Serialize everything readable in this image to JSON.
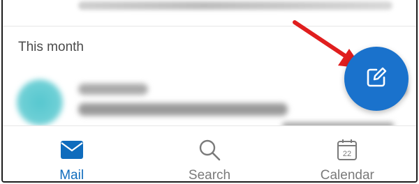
{
  "list": {
    "section_heading": "This month"
  },
  "compose": {
    "icon": "compose-icon"
  },
  "tabs": [
    {
      "label": "Mail",
      "icon": "mail-icon",
      "active": true
    },
    {
      "label": "Search",
      "icon": "search-icon",
      "active": false
    },
    {
      "label": "Calendar",
      "icon": "calendar-icon",
      "active": false,
      "badge": "22"
    }
  ],
  "colors": {
    "accent": "#1a72cc",
    "active_tab": "#0f6cbd",
    "inactive_tab": "#7a7a7a",
    "annotation_arrow": "#e01e1e"
  }
}
